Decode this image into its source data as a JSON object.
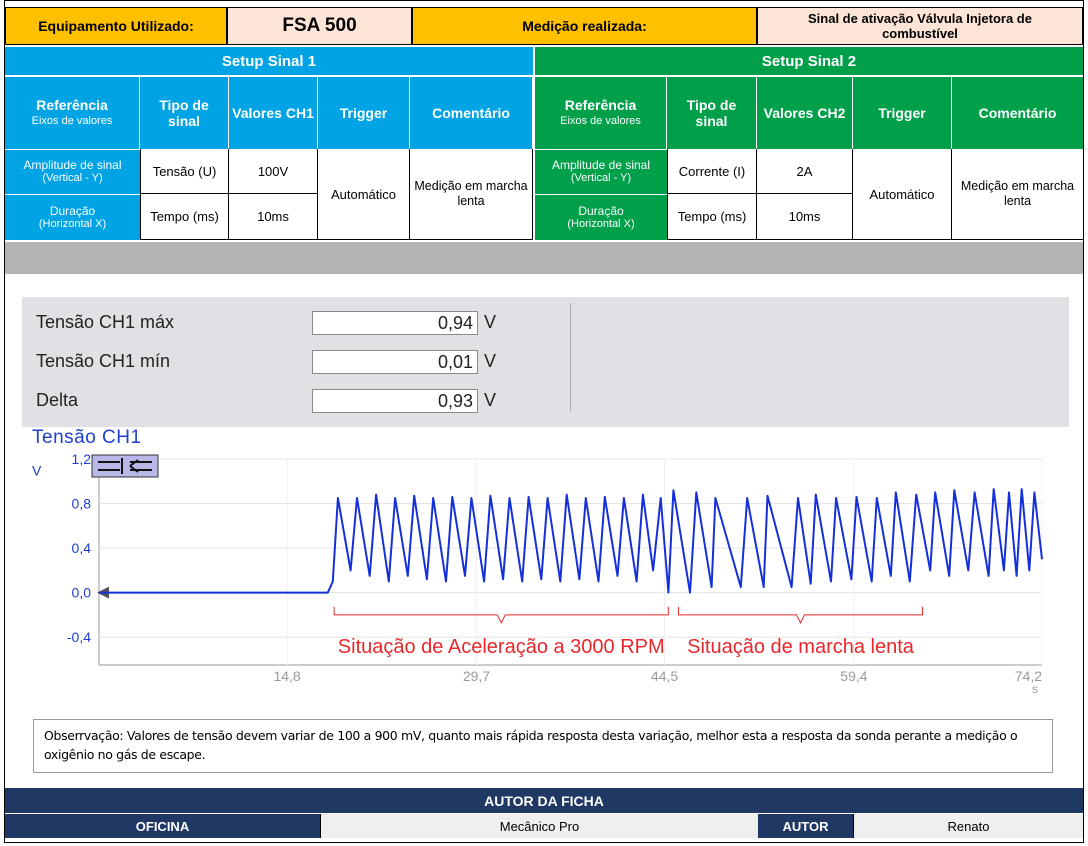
{
  "header": {
    "equip_label": "Equipamento Utilizado:",
    "equip_value": "FSA 500",
    "medicao_label": "Medição realizada:",
    "medicao_value": "Sinal de ativação Válvula Injetora de combustível"
  },
  "setup1": {
    "title": "Setup Sinal 1",
    "col_ref": "Referência",
    "col_ref_sub": "Eixos de valores",
    "col_tipo": "Tipo de sinal",
    "col_valores": "Valores CH1",
    "col_trigger": "Trigger",
    "col_comentario": "Comentário",
    "row1_label": "Amplitude de sinal",
    "row1_sub": "(Vertical - Y)",
    "row1_tipo": "Tensão (U)",
    "row1_valor": "100V",
    "row2_label": "Duração",
    "row2_sub": "(Horizontal X)",
    "row2_tipo": "Tempo (ms)",
    "row2_valor": "10ms",
    "trigger": "Automático",
    "comentario": "Medição em marcha lenta"
  },
  "setup2": {
    "title": "Setup Sinal 2",
    "col_ref": "Referência",
    "col_ref_sub": "Eixos de valores",
    "col_tipo": "Tipo de sinal",
    "col_valores": "Valores CH2",
    "col_trigger": "Trigger",
    "col_comentario": "Comentário",
    "row1_label": "Amplitude de sinal",
    "row1_sub": "(Vertical - Y)",
    "row1_tipo": "Corrente (I)",
    "row1_valor": "2A",
    "row2_label": "Duração",
    "row2_sub": "(Horizontal X)",
    "row2_tipo": "Tempo (ms)",
    "row2_valor": "10ms",
    "trigger": "Automático",
    "comentario": "Medição em marcha lenta"
  },
  "measurements": [
    {
      "label": "Tensão CH1 máx",
      "value": "0,94",
      "unit": "V"
    },
    {
      "label": "Tensão CH1 mín",
      "value": "0,01",
      "unit": "V"
    },
    {
      "label": "Delta",
      "value": "0,93",
      "unit": "V"
    }
  ],
  "chart_data": {
    "type": "line",
    "title": "Tensão CH1",
    "ylabel": "V",
    "xlabel": "s",
    "ylim": [
      -0.65,
      1.2
    ],
    "xlim": [
      0,
      74.2
    ],
    "y_ticks": [
      "1,2",
      "0,8",
      "0,4",
      "0,0",
      "-0,4"
    ],
    "y_tick_values": [
      1.2,
      0.8,
      0.4,
      0.0,
      -0.4
    ],
    "x_ticks": [
      "14,8",
      "29,7",
      "44,5",
      "59,4",
      "74,2"
    ],
    "x_tick_values": [
      14.8,
      29.7,
      44.5,
      59.4,
      74.2
    ],
    "series": [
      {
        "name": "",
        "color": "#1530d8",
        "x": [
          0,
          18,
          18.4,
          18.8,
          19.8,
          20.3,
          21.3,
          21.8,
          22.8,
          23.3,
          24.3,
          24.8,
          25.8,
          26.3,
          27.3,
          27.8,
          28.8,
          29.3,
          30.3,
          30.8,
          31.8,
          32.3,
          33.3,
          33.8,
          34.8,
          35.3,
          36.3,
          36.8,
          37.8,
          38.3,
          39.3,
          39.8,
          40.8,
          41.3,
          42.3,
          42.8,
          43.6,
          44.2,
          44.8,
          45.2,
          46.5,
          47.0,
          48.2,
          48.5,
          50.5,
          51.0,
          52.3,
          52.6,
          54.5,
          55.0,
          56.0,
          56.4,
          57.6,
          58.0,
          59.2,
          59.6,
          60.8,
          61.2,
          62.3,
          62.7,
          63.8,
          64.3,
          65.4,
          65.8,
          66.9,
          67.3,
          68.4,
          68.9,
          70.0,
          70.4,
          71.2,
          71.6,
          72.2,
          72.6,
          73.2,
          73.6,
          74.2
        ],
        "y": [
          0.0,
          0.0,
          0.1,
          0.85,
          0.2,
          0.85,
          0.15,
          0.88,
          0.1,
          0.85,
          0.15,
          0.87,
          0.12,
          0.85,
          0.1,
          0.86,
          0.15,
          0.85,
          0.1,
          0.87,
          0.12,
          0.85,
          0.1,
          0.86,
          0.12,
          0.85,
          0.1,
          0.88,
          0.12,
          0.85,
          0.1,
          0.86,
          0.15,
          0.85,
          0.1,
          0.88,
          0.2,
          0.85,
          0.0,
          0.92,
          0.0,
          0.9,
          0.05,
          0.85,
          0.05,
          0.85,
          0.05,
          0.87,
          0.05,
          0.85,
          0.08,
          0.88,
          0.1,
          0.85,
          0.12,
          0.86,
          0.1,
          0.85,
          0.15,
          0.9,
          0.1,
          0.88,
          0.2,
          0.9,
          0.15,
          0.92,
          0.2,
          0.9,
          0.15,
          0.93,
          0.2,
          0.9,
          0.15,
          0.93,
          0.2,
          0.9,
          0.3
        ]
      }
    ],
    "annotations": [
      {
        "text": "Situação de Aceleração a 3000 RPM",
        "x_start": 18.5,
        "x_end": 44.8
      },
      {
        "text": "Situação de marcha lenta",
        "x_start": 45.6,
        "x_end": 64.8
      }
    ]
  },
  "observation": "Obserrvação: Valores de tensão devem variar de 100 a 900 mV, quanto mais rápida resposta desta variação, melhor esta a resposta da sonda perante a medição o oxigênio no gás de escape.",
  "footer": {
    "autor_title": "AUTOR DA FICHA",
    "oficina_label": "OFICINA",
    "oficina_value": "Mecânico Pro",
    "autor_label": "AUTOR",
    "autor_value": "Renato"
  },
  "colors": {
    "orange": "#ffc000",
    "peach": "#fce4d6",
    "blue": "#00a3e4",
    "green": "#00a04a",
    "navy": "#203864",
    "trace": "#1530d8",
    "annotation": "#e8282b"
  }
}
